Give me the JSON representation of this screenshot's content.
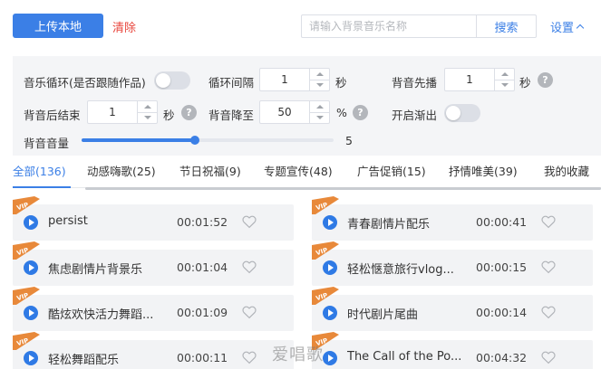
{
  "toolbar": {
    "upload_label": "上传本地",
    "clear_label": "清除",
    "search_placeholder": "请输入背景音乐名称",
    "search_label": "搜索",
    "settings_label": "设置"
  },
  "settings": {
    "loop_label": "音乐循环(是否跟随作品)",
    "loop_enabled": false,
    "interval_label": "循环间隔",
    "interval_value": "1",
    "interval_unit": "秒",
    "pre_play_label": "背音先播",
    "pre_play_value": "1",
    "pre_play_unit": "秒",
    "after_end_label": "背音后结束",
    "after_end_value": "1",
    "after_end_unit": "秒",
    "reduce_label": "背音降至",
    "reduce_value": "50",
    "reduce_unit": "%",
    "fade_label": "开启渐出",
    "fade_enabled": false,
    "volume_label": "背音音量",
    "volume_value": "5",
    "volume_fraction": 0.45,
    "help_glyph": "?"
  },
  "tabs": [
    {
      "label": "全部(136)",
      "active": true
    },
    {
      "label": "动感嗨歌(25)",
      "active": false
    },
    {
      "label": "节日祝福(9)",
      "active": false
    },
    {
      "label": "专题宣传(48)",
      "active": false
    },
    {
      "label": "广告促销(15)",
      "active": false
    },
    {
      "label": "抒情唯美(39)",
      "active": false
    },
    {
      "label": "我的收藏",
      "active": false
    }
  ],
  "tracks": [
    {
      "name": "persist",
      "duration": "00:01:52",
      "vip": true
    },
    {
      "name": "青春剧情片配乐",
      "duration": "00:00:41",
      "vip": true
    },
    {
      "name": "焦虑剧情片背景乐",
      "duration": "00:01:04",
      "vip": true
    },
    {
      "name": "轻松惬意旅行vlog...",
      "duration": "00:00:15",
      "vip": true
    },
    {
      "name": "酷炫欢快活力舞蹈...",
      "duration": "00:01:09",
      "vip": true
    },
    {
      "name": "时代剧片尾曲",
      "duration": "00:00:14",
      "vip": true
    },
    {
      "name": "轻松舞蹈配乐",
      "duration": "00:00:11",
      "vip": true
    },
    {
      "name": "The Call of the Po...",
      "duration": "00:04:32",
      "vip": true
    }
  ],
  "vip_badge": "VIP",
  "watermark": "爱唱歌",
  "colors": {
    "accent": "#3b7fe6",
    "danger": "#e8453c",
    "vip": "#e8893a",
    "panel_bg": "#f4f5f7",
    "card_bg": "#f2f3f5"
  }
}
